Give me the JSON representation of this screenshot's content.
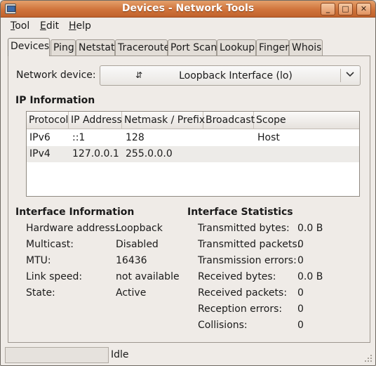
{
  "window": {
    "title": "Devices - Network Tools"
  },
  "menubar": {
    "items": [
      {
        "label": "Tool"
      },
      {
        "label": "Edit"
      },
      {
        "label": "Help"
      }
    ]
  },
  "tabs": [
    {
      "label": "Devices",
      "active": true
    },
    {
      "label": "Ping"
    },
    {
      "label": "Netstat"
    },
    {
      "label": "Traceroute"
    },
    {
      "label": "Port Scan"
    },
    {
      "label": "Lookup"
    },
    {
      "label": "Finger"
    },
    {
      "label": "Whois"
    }
  ],
  "device": {
    "label": "Network device:",
    "selected": "Loopback Interface (lo)",
    "icon": "refresh-arrows-icon"
  },
  "ip_info": {
    "heading": "IP Information",
    "columns": [
      "Protocol",
      "IP Address",
      "Netmask / Prefix",
      "Broadcast",
      "Scope"
    ],
    "rows": [
      [
        "IPv6",
        "::1",
        "128",
        "",
        "Host"
      ],
      [
        "IPv4",
        "127.0.0.1",
        "255.0.0.0",
        "",
        ""
      ]
    ]
  },
  "interface_info": {
    "heading": "Interface Information",
    "rows": [
      {
        "label": "Hardware address:",
        "value": "Loopback"
      },
      {
        "label": "Multicast:",
        "value": "Disabled"
      },
      {
        "label": "MTU:",
        "value": "16436"
      },
      {
        "label": "Link speed:",
        "value": "not available"
      },
      {
        "label": "State:",
        "value": "Active"
      }
    ]
  },
  "interface_stats": {
    "heading": "Interface Statistics",
    "rows": [
      {
        "label": "Transmitted bytes:",
        "value": "0.0 B"
      },
      {
        "label": "Transmitted packets:",
        "value": "0"
      },
      {
        "label": "Transmission errors:",
        "value": "0"
      },
      {
        "label": "Received bytes:",
        "value": "0.0 B"
      },
      {
        "label": "Received packets:",
        "value": "0"
      },
      {
        "label": "Reception errors:",
        "value": "0"
      },
      {
        "label": "Collisions:",
        "value": "0"
      }
    ]
  },
  "statusbar": {
    "text": "Idle"
  },
  "colors": {
    "titlebar": "#d0733b",
    "window_bg": "#efebe7",
    "row_alt": "#edebe8"
  }
}
